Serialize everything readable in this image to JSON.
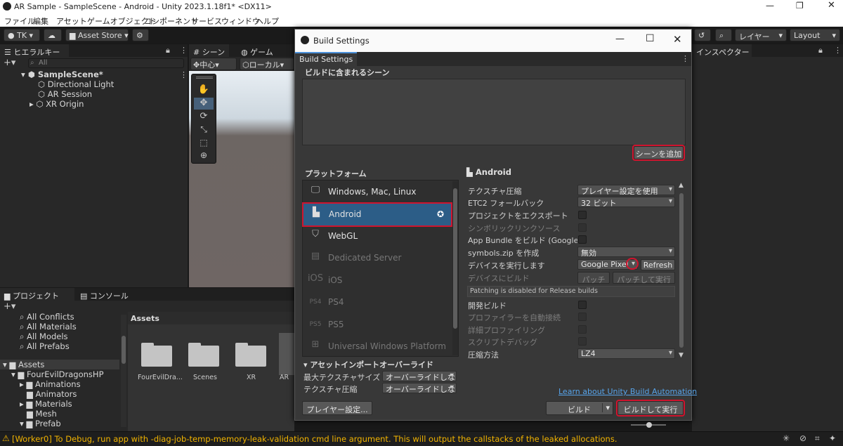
{
  "window": {
    "title": "AR Sample - SampleScene - Android - Unity 2023.1.18f1* <DX11>"
  },
  "menu": [
    "ファイル",
    "編集",
    "アセット",
    "ゲームオブジェクト",
    "コンポーネント",
    "サービス",
    "ウィンドウ",
    "ヘルプ"
  ],
  "toolbar": {
    "account": "TK",
    "asset_store": "Asset Store",
    "layers": "レイヤー",
    "layout": "Layout"
  },
  "hierarchy": {
    "tab": "ヒエラルキー",
    "search": "All",
    "scene": "SampleScene*",
    "items": [
      "Directional Light",
      "AR Session",
      "XR Origin"
    ]
  },
  "scene": {
    "tab_scene": "シーン",
    "tab_game": "ゲーム",
    "pivot": "中心",
    "space": "ローカル"
  },
  "inspector": {
    "tab": "インスペクター"
  },
  "project": {
    "tab_project": "プロジェクト",
    "tab_console": "コンソール",
    "favorites": [
      "All Conflicts",
      "All Materials",
      "All Models",
      "All Prefabs"
    ],
    "assets_root": "Assets",
    "tree": [
      "FourEvilDragonsHP",
      "Animations",
      "Animators",
      "Materials",
      "Mesh",
      "Prefab"
    ],
    "assets_header": "Assets",
    "assets": [
      "FourEvilDra...",
      "Scenes",
      "XR",
      "AR"
    ]
  },
  "dialog": {
    "title": "Build Settings",
    "tab": "Build Settings",
    "scenes_label": "ビルドに含まれるシーン",
    "add_scene": "シーンを追加",
    "platform_label": "プラットフォーム",
    "platforms": [
      {
        "name": "Windows, Mac, Linux",
        "icon": "monitor-icon",
        "enabled": true
      },
      {
        "name": "Android",
        "icon": "android-icon",
        "enabled": true,
        "selected": true
      },
      {
        "name": "WebGL",
        "icon": "html5-icon",
        "enabled": true
      },
      {
        "name": "Dedicated Server",
        "icon": "server-icon",
        "enabled": false
      },
      {
        "name": "iOS",
        "icon": "ios-icon",
        "enabled": false
      },
      {
        "name": "PS4",
        "icon": "ps4-icon",
        "enabled": false
      },
      {
        "name": "PS5",
        "icon": "ps5-icon",
        "enabled": false
      },
      {
        "name": "Universal Windows Platform",
        "icon": "windows-icon",
        "enabled": false
      }
    ],
    "selected_platform": "Android",
    "settings": {
      "texture_compression": {
        "label": "テクスチャ圧縮",
        "value": "プレイヤー設定を使用"
      },
      "etc2_fallback": {
        "label": "ETC2 フォールバック",
        "value": "32 ビット"
      },
      "export_project": {
        "label": "プロジェクトをエクスポート"
      },
      "symlink_sources": {
        "label": "シンボリックリンクソース"
      },
      "app_bundle": {
        "label": "App Bundle をビルド (Google P"
      },
      "symbols_zip": {
        "label": "symbols.zip を作成",
        "value": "無効"
      },
      "run_device": {
        "label": "デバイスを実行します",
        "value": "Google Pixel",
        "refresh": "Refresh"
      },
      "build_to_device": {
        "label": "デバイスにビルド",
        "patch": "パッチ",
        "patch_run": "パッチして実行"
      },
      "patch_note": "Patching is disabled for Release builds",
      "dev_build": {
        "label": "開発ビルド"
      },
      "autoconnect_profiler": {
        "label": "プロファイラーを自動接続"
      },
      "deep_profiling": {
        "label": "詳細プロファイリング"
      },
      "script_debug": {
        "label": "スクリプトデバッグ"
      },
      "compression": {
        "label": "圧縮方法",
        "value": "LZ4"
      }
    },
    "asset_import": {
      "label": "アセットインポートオーバーライド",
      "max_texture": {
        "label": "最大テクスチャサイズ",
        "value": "オーバーライドしな"
      },
      "texture_compression": {
        "label": "テクスチャ圧縮",
        "value": "オーバーライドしな"
      }
    },
    "learn_link": "Learn about Unity Build Automation",
    "player_settings": "プレイヤー設定...",
    "build": "ビルド",
    "build_and_run": "ビルドして実行"
  },
  "status": {
    "message": "[Worker0] To Debug, run app with -diag-job-temp-memory-leak-validation cmd line argument. This will output the callstacks of the leaked allocations."
  }
}
